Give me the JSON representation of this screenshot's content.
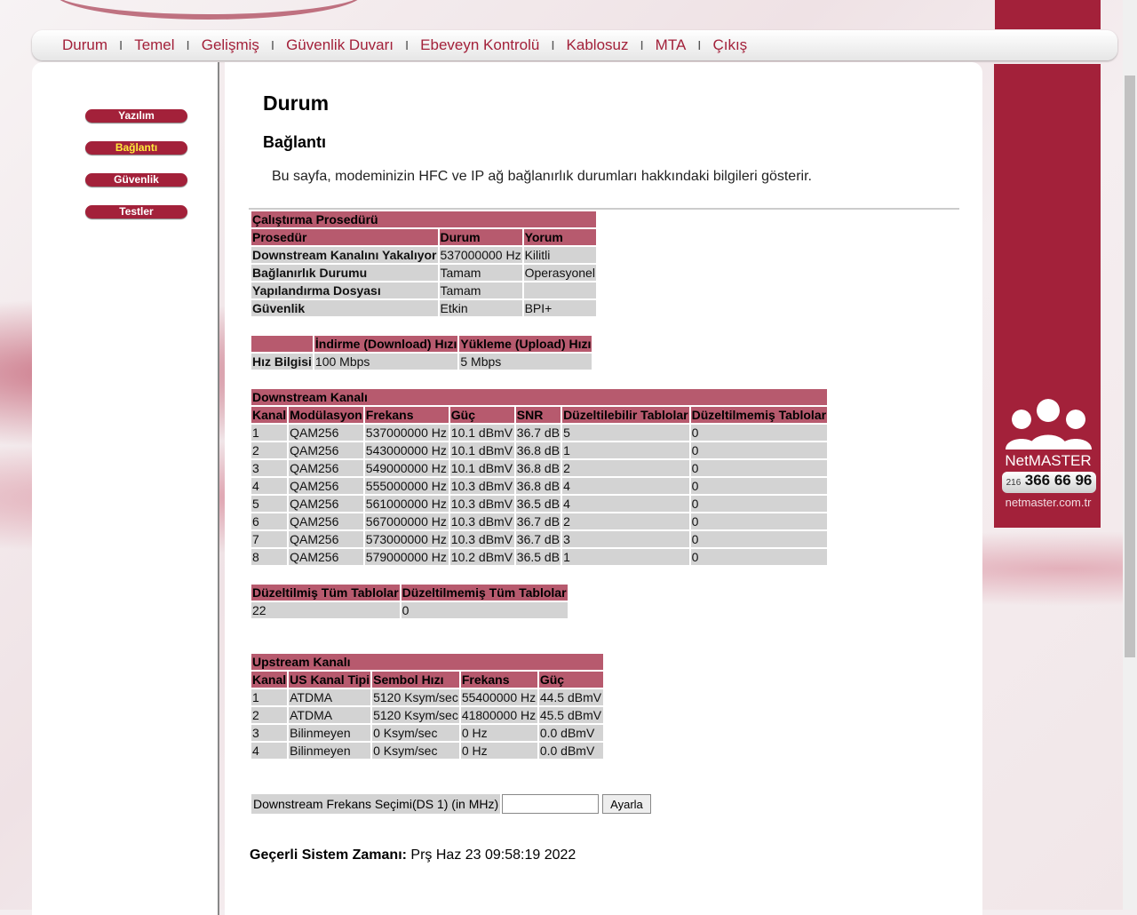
{
  "nav": {
    "items": [
      "Durum",
      "Temel",
      "Gelişmiş",
      "Güvenlik Duvarı",
      "Ebeveyn Kontrolü",
      "Kablosuz",
      "MTA",
      "Çıkış"
    ],
    "separator": "I"
  },
  "sidebar": {
    "items": [
      {
        "label": "Yazılım",
        "active": false
      },
      {
        "label": "Bağlantı",
        "active": true
      },
      {
        "label": "Güvenlik",
        "active": false
      },
      {
        "label": "Testler",
        "active": false
      }
    ]
  },
  "page": {
    "title": "Durum",
    "subtitle": "Bağlantı",
    "description": "Bu sayfa, modeminizin HFC ve IP ağ bağlanırlık durumları hakkındaki bilgileri gösterir."
  },
  "startup": {
    "title": "Çalıştırma Prosedürü",
    "headers": [
      "Prosedür",
      "Durum",
      "Yorum"
    ],
    "rows": [
      [
        "Downstream Kanalını Yakalıyor",
        "537000000 Hz",
        "Kilitli"
      ],
      [
        "Bağlanırlık Durumu",
        "Tamam",
        "Operasyonel"
      ],
      [
        "Yapılandırma Dosyası",
        "Tamam",
        ""
      ],
      [
        "Güvenlik",
        "Etkin",
        "BPI+"
      ]
    ]
  },
  "speed": {
    "headers": [
      "",
      "İndirme (Download) Hızı",
      "Yükleme (Upload) Hızı"
    ],
    "row_label": "Hız Bilgisi",
    "values": [
      "100 Mbps",
      "5 Mbps"
    ]
  },
  "downstream": {
    "title": "Downstream Kanalı",
    "headers": [
      "Kanal",
      "Modülasyon",
      "Frekans",
      "Güç",
      "SNR",
      "Düzeltilebilir Tablolar",
      "Düzeltilmemiş Tablolar"
    ],
    "rows": [
      [
        "1",
        "QAM256",
        "537000000 Hz",
        "10.1 dBmV",
        "36.7 dB",
        "5",
        "0"
      ],
      [
        "2",
        "QAM256",
        "543000000 Hz",
        "10.1 dBmV",
        "36.8 dB",
        "1",
        "0"
      ],
      [
        "3",
        "QAM256",
        "549000000 Hz",
        "10.1 dBmV",
        "36.8 dB",
        "2",
        "0"
      ],
      [
        "4",
        "QAM256",
        "555000000 Hz",
        "10.3 dBmV",
        "36.8 dB",
        "4",
        "0"
      ],
      [
        "5",
        "QAM256",
        "561000000 Hz",
        "10.3 dBmV",
        "36.5 dB",
        "4",
        "0"
      ],
      [
        "6",
        "QAM256",
        "567000000 Hz",
        "10.3 dBmV",
        "36.7 dB",
        "2",
        "0"
      ],
      [
        "7",
        "QAM256",
        "573000000 Hz",
        "10.3 dBmV",
        "36.7 dB",
        "3",
        "0"
      ],
      [
        "8",
        "QAM256",
        "579000000 Hz",
        "10.2 dBmV",
        "36.5 dB",
        "1",
        "0"
      ]
    ]
  },
  "totals": {
    "headers": [
      "Düzeltilmiş Tüm Tablolar",
      "Düzeltilmemiş Tüm Tablolar"
    ],
    "values": [
      "22",
      "0"
    ]
  },
  "upstream": {
    "title": "Upstream Kanalı",
    "headers": [
      "Kanal",
      "US Kanal Tipi",
      "Sembol Hızı",
      "Frekans",
      "Güç"
    ],
    "rows": [
      [
        "1",
        "ATDMA",
        "5120 Ksym/sec",
        "55400000 Hz",
        "44.5 dBmV"
      ],
      [
        "2",
        "ATDMA",
        "5120 Ksym/sec",
        "41800000 Hz",
        "45.5 dBmV"
      ],
      [
        "3",
        "Bilinmeyen",
        "0 Ksym/sec",
        "0 Hz",
        "0.0 dBmV"
      ],
      [
        "4",
        "Bilinmeyen",
        "0 Ksym/sec",
        "0 Hz",
        "0.0 dBmV"
      ]
    ]
  },
  "freq_select": {
    "label": "Downstream Frekans Seçimi(DS 1) (in MHz)",
    "value": "",
    "button": "Ayarla"
  },
  "system_time": {
    "label": "Geçerli Sistem Zamanı:",
    "value": "Prş Haz 23 09:58:19 2022"
  },
  "brand": {
    "name": "NetMASTER",
    "phone_prefix": "216",
    "phone": "366 66 96",
    "url": "netmaster.com.tr",
    "accent": "#a3213a",
    "header_cell": "#b75a6e",
    "data_cell": "#d3d3d3"
  }
}
